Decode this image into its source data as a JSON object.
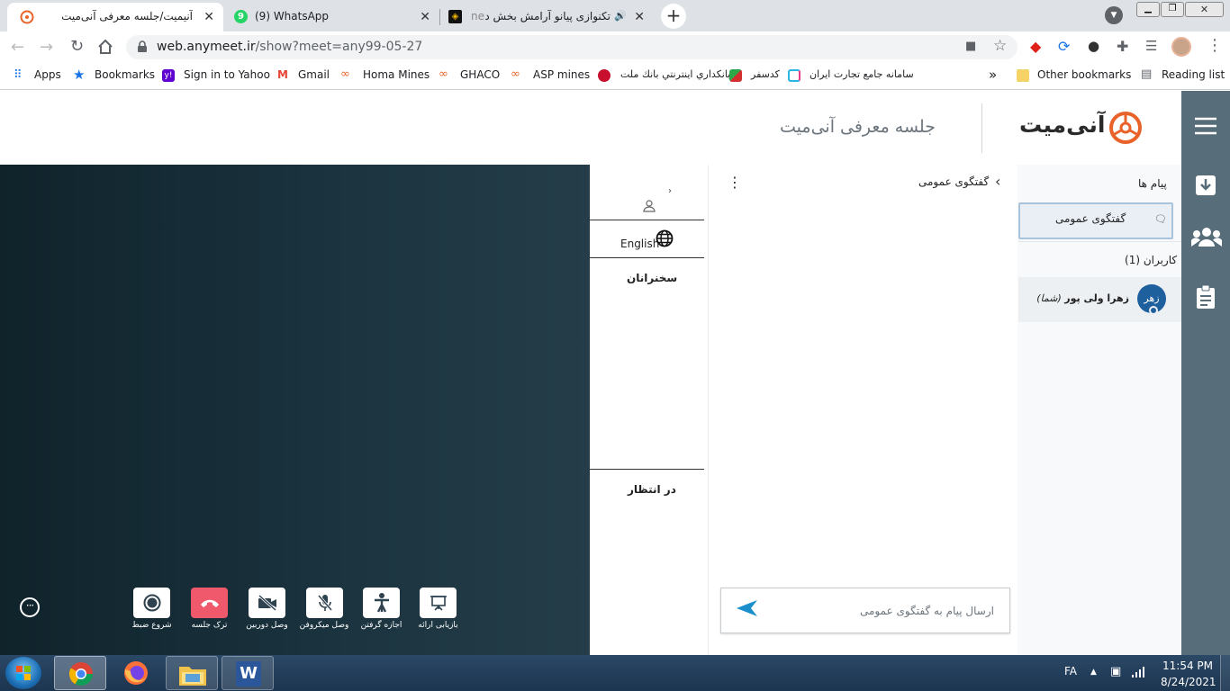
{
  "browser": {
    "tabs": [
      {
        "title": "آنیمیت/جلسه معرفی آنی‌میت",
        "active": true
      },
      {
        "title": "(9) WhatsApp",
        "badge": "9",
        "active": false
      },
      {
        "title": "تکنوازی پیانو آرامش بخش در آلبوم",
        "prefix": "ne",
        "active": false
      }
    ],
    "url_host": "web.anymeet.ir",
    "url_path": "/show?meet=any99-05-27",
    "bookmarks": [
      {
        "label": "Apps",
        "icon": "apps-grid-icon"
      },
      {
        "label": "Bookmarks",
        "icon": "star-icon"
      },
      {
        "label": "Sign in to Yahoo",
        "icon": "yahoo-icon"
      },
      {
        "label": "Gmail",
        "icon": "gmail-icon"
      },
      {
        "label": "Homa Mines",
        "icon": "bookmark-favicon-icon"
      },
      {
        "label": "GHACO",
        "icon": "bookmark-favicon-icon"
      },
      {
        "label": "ASP mines",
        "icon": "bookmark-favicon-icon"
      },
      {
        "label": "بانكداري اينترنتي بانك ملت",
        "icon": "mellat-icon"
      },
      {
        "label": "کدسفر",
        "icon": "codsafar-icon"
      },
      {
        "label": "سامانه جامع تجارت ایران",
        "icon": "ntsw-icon"
      }
    ],
    "bookmarks_overflow": "»",
    "other_bookmarks": "Other bookmarks",
    "reading_list": "Reading list"
  },
  "app": {
    "meeting_title": "جلسه معرفی آنی‌میت",
    "brand": "آنی‌میت"
  },
  "speakers_panel": {
    "language": "English",
    "speakers_heading": "سخنرانان",
    "waiting_heading": "در انتظار"
  },
  "chat": {
    "title": "گفتگوی عمومی",
    "input_placeholder": "ارسال پیام به گفتگوی عمومی"
  },
  "sidebar": {
    "messages_heading": "پیام ها",
    "public_chat_item": "گفتگوی عمومی",
    "users_heading": "کاربران (1)",
    "users": [
      {
        "avatar_text": "زهر",
        "name": "زهرا ولی پور",
        "suffix": "(شما)"
      }
    ]
  },
  "controls": [
    {
      "label": "بازیابی ارائه",
      "icon": "presentation-icon"
    },
    {
      "label": "اجازه گرفتن",
      "icon": "raise-hand-icon"
    },
    {
      "label": "وصل میکروفن",
      "icon": "mic-off-icon"
    },
    {
      "label": "وصل دوربین",
      "icon": "camera-off-icon"
    },
    {
      "label": "ترک جلسه",
      "icon": "hangup-icon"
    },
    {
      "label": "شروع ضبط",
      "icon": "record-icon"
    }
  ],
  "taskbar": {
    "lang": "FA",
    "time": "11:54 PM",
    "date": "8/24/2021"
  },
  "colors": {
    "accent": "#e8622a",
    "rail": "#576d7a",
    "stage": "#1b3440",
    "hangup": "#f0596b",
    "send_arrow": "#1a8fc9",
    "avatar": "#1e5f9e"
  }
}
